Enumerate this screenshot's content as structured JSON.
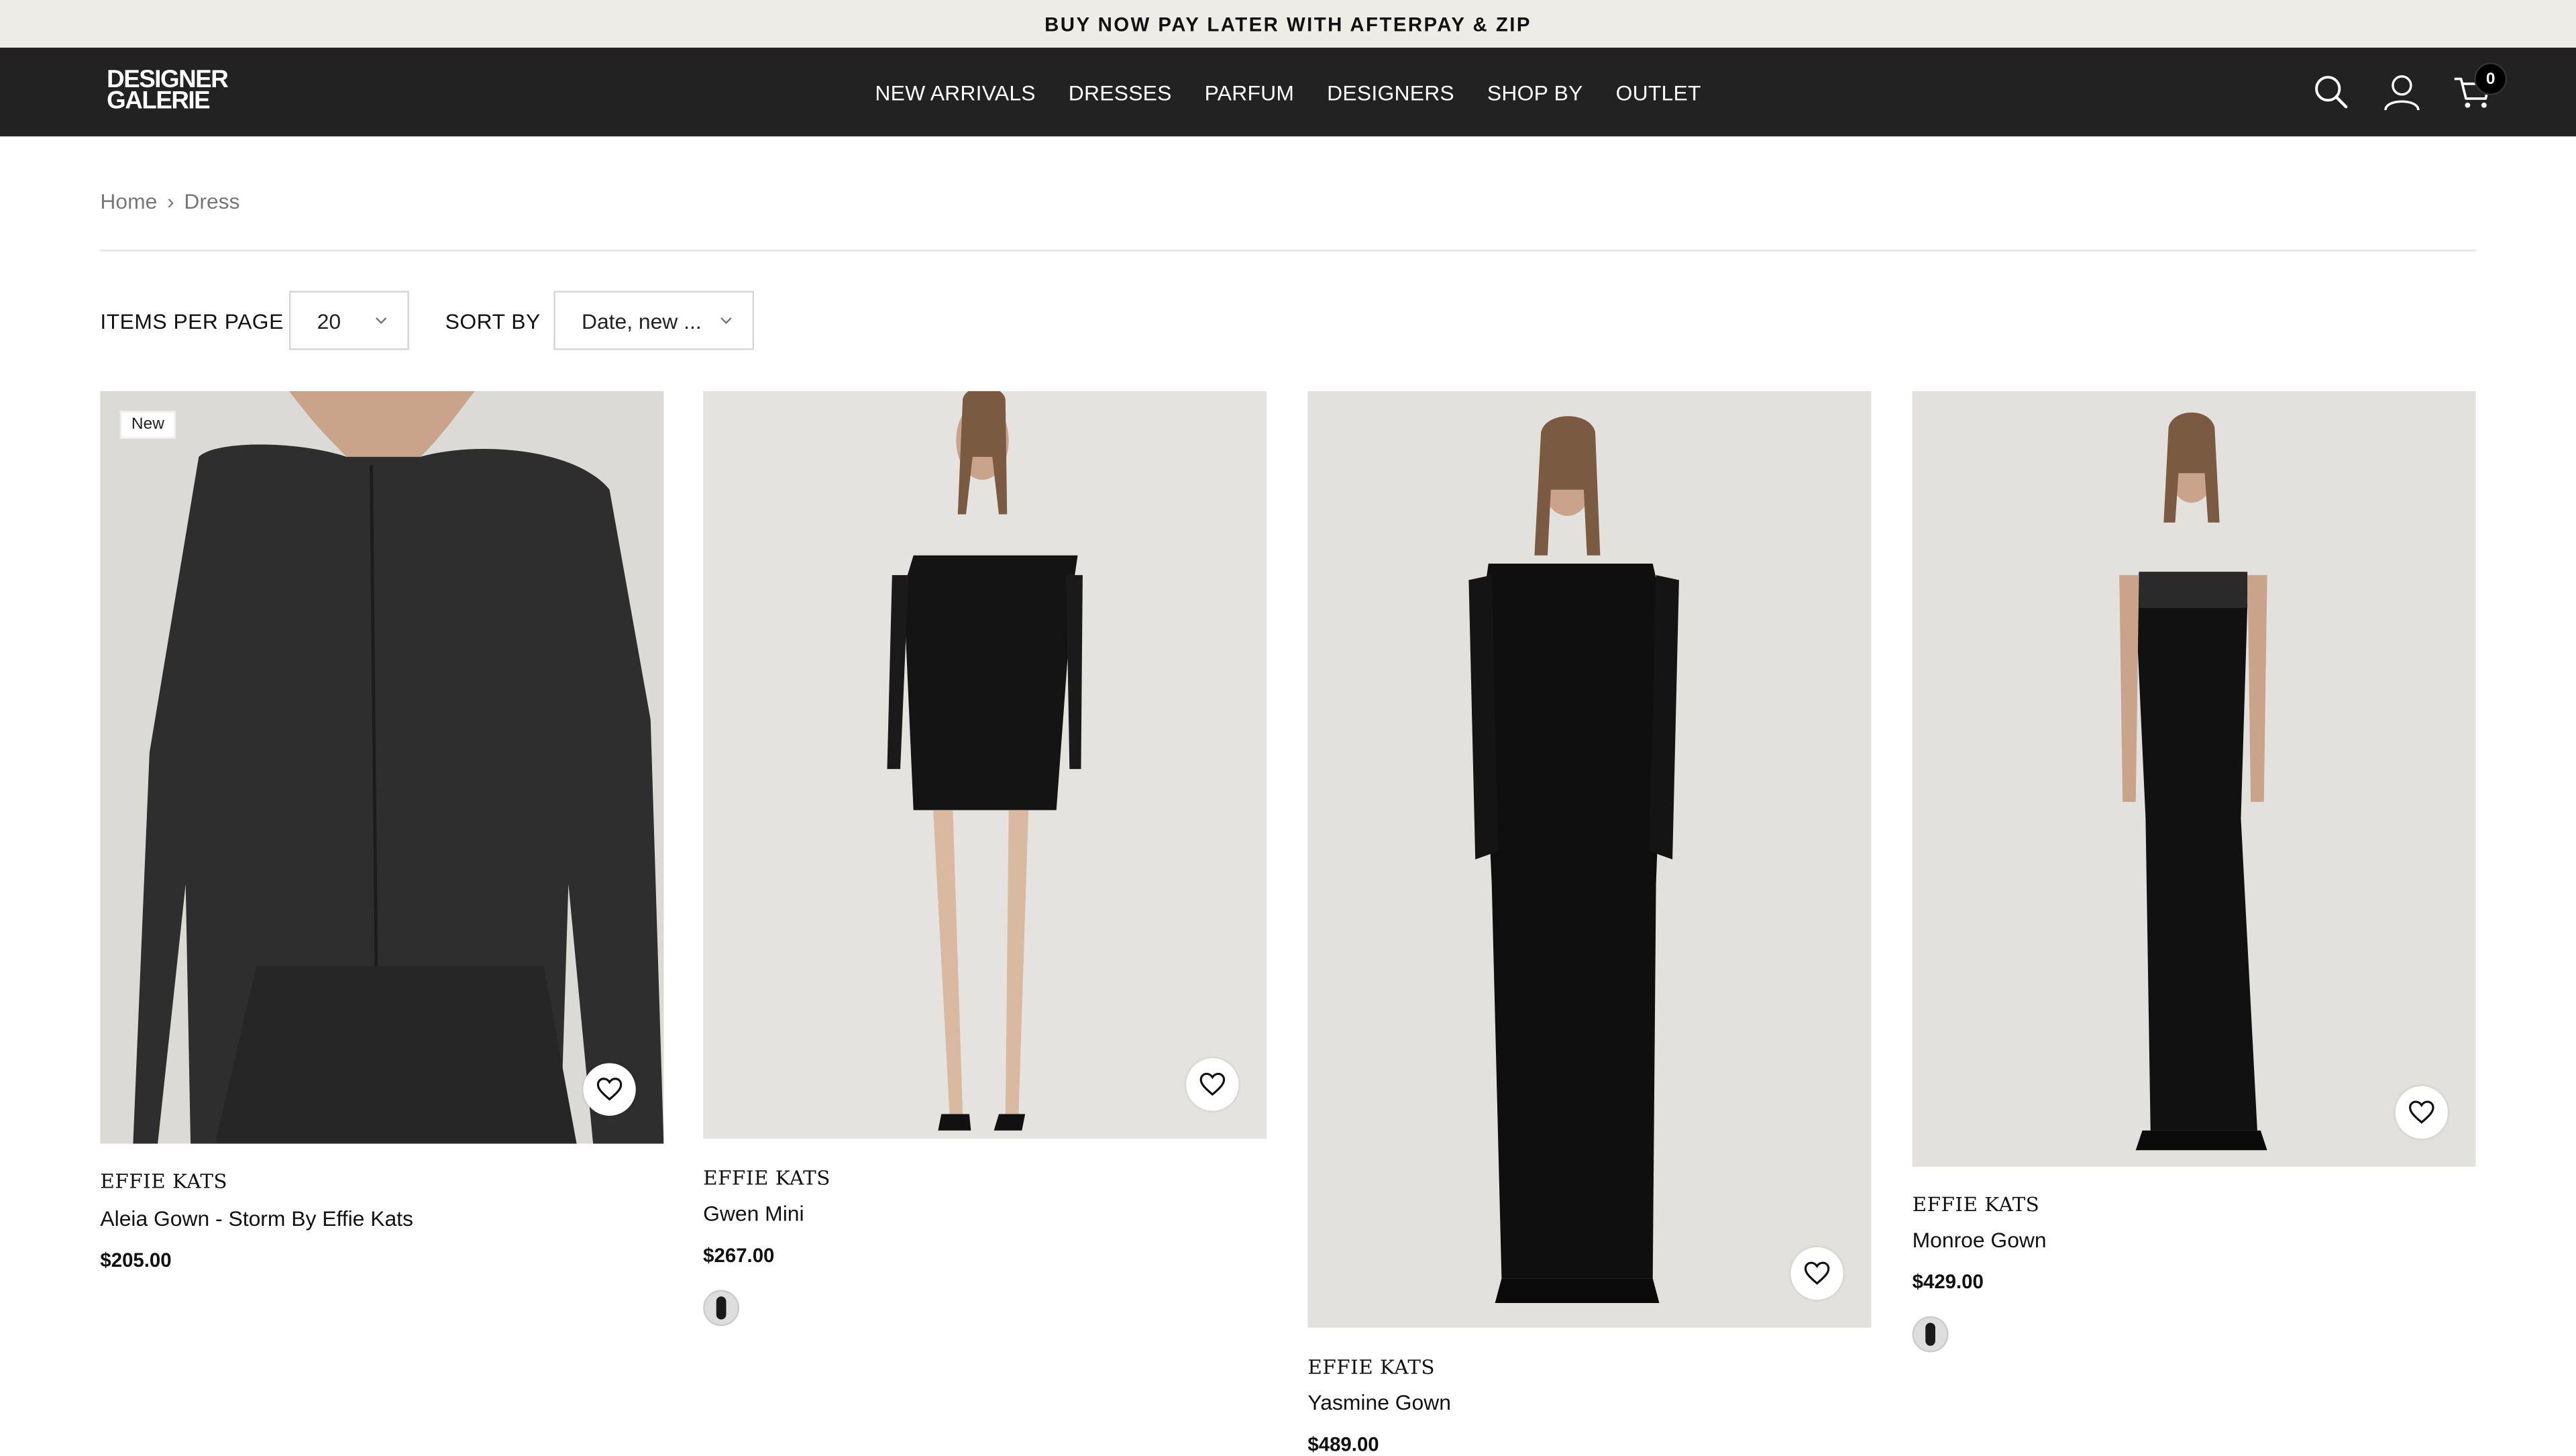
{
  "promo": {
    "text": "BUY NOW PAY LATER WITH AFTERPAY & ZIP"
  },
  "header": {
    "logo_line1": "DESIGNER",
    "logo_line2": "GALERIE",
    "nav": [
      "NEW ARRIVALS",
      "DRESSES",
      "PARFUM",
      "DESIGNERS",
      "SHOP BY",
      "OUTLET"
    ],
    "cart_count": "0",
    "icons": [
      "search-icon",
      "account-icon",
      "cart-icon"
    ]
  },
  "breadcrumb": {
    "home": "Home",
    "separator": "›",
    "current": "Dress"
  },
  "toolbar": {
    "items_label": "ITEMS PER PAGE",
    "items_value": "20",
    "sort_label": "SORT BY",
    "sort_value": "Date, new ..."
  },
  "colors": {
    "header_bg": "#222222",
    "promo_bg": "#eeece7",
    "accent": "#000000"
  },
  "products": [
    {
      "badge": "New",
      "brand": "EFFIE KATS",
      "name": "Aleia Gown - Storm By Effie Kats",
      "price": "$205.00",
      "has_swatch": false
    },
    {
      "badge": "",
      "brand": "EFFIE KATS",
      "name": "Gwen Mini",
      "price": "$267.00",
      "has_swatch": true
    },
    {
      "badge": "",
      "brand": "EFFIE KATS",
      "name": "Yasmine Gown",
      "price": "$489.00",
      "has_swatch": false
    },
    {
      "badge": "",
      "brand": "EFFIE KATS",
      "name": "Monroe Gown",
      "price": "$429.00",
      "has_swatch": true
    }
  ]
}
